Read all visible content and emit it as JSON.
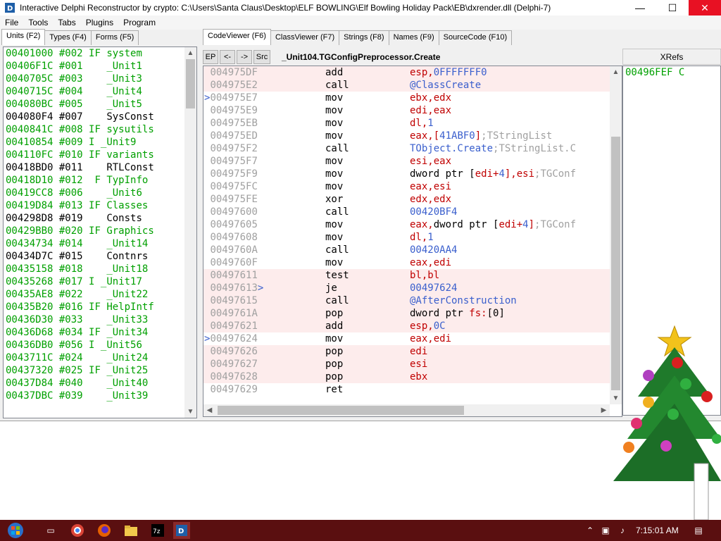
{
  "window": {
    "title": "Interactive Delphi Reconstructor by crypto: C:\\Users\\Santa Claus\\Desktop\\ELF BOWLING\\Elf Bowling Holiday Pack\\EB\\dxrender.dll (Delphi-7)",
    "minimize": "—",
    "maximize": "☐",
    "close": "✕"
  },
  "menu": [
    "File",
    "Tools",
    "Tabs",
    "Plugins",
    "Program"
  ],
  "left_tabs": [
    "Units (F2)",
    "Types (F4)",
    "Forms (F5)"
  ],
  "units": [
    {
      "addr": "00401000",
      "num": "#002",
      "flag": "IF",
      "name": "system",
      "color": "green"
    },
    {
      "addr": "00406F1C",
      "num": "#001",
      "flag": "",
      "name": "_Unit1",
      "color": "green"
    },
    {
      "addr": "0040705C",
      "num": "#003",
      "flag": "",
      "name": "_Unit3",
      "color": "green"
    },
    {
      "addr": "0040715C",
      "num": "#004",
      "flag": "",
      "name": "_Unit4",
      "color": "green"
    },
    {
      "addr": "004080BC",
      "num": "#005",
      "flag": "",
      "name": "_Unit5",
      "color": "green"
    },
    {
      "addr": "004080F4",
      "num": "#007",
      "flag": "",
      "name": "SysConst",
      "color": "black"
    },
    {
      "addr": "0040841C",
      "num": "#008",
      "flag": "IF",
      "name": "sysutils",
      "color": "green"
    },
    {
      "addr": "00410854",
      "num": "#009",
      "flag": "I",
      "name": "_Unit9",
      "color": "green"
    },
    {
      "addr": "004110FC",
      "num": "#010",
      "flag": "IF",
      "name": "variants",
      "color": "green"
    },
    {
      "addr": "00418BD0",
      "num": "#011",
      "flag": "",
      "name": "RTLConst",
      "color": "black"
    },
    {
      "addr": "00418D10",
      "num": "#012",
      "flag": " F",
      "name": "TypInfo",
      "color": "green"
    },
    {
      "addr": "00419CC8",
      "num": "#006",
      "flag": "",
      "name": "_Unit6",
      "color": "green"
    },
    {
      "addr": "00419D84",
      "num": "#013",
      "flag": "IF",
      "name": "Classes",
      "color": "green"
    },
    {
      "addr": "004298D8",
      "num": "#019",
      "flag": "",
      "name": "Consts",
      "color": "black"
    },
    {
      "addr": "00429BB0",
      "num": "#020",
      "flag": "IF",
      "name": "Graphics",
      "color": "green"
    },
    {
      "addr": "00434734",
      "num": "#014",
      "flag": "",
      "name": "_Unit14",
      "color": "green"
    },
    {
      "addr": "00434D7C",
      "num": "#015",
      "flag": "",
      "name": "Contnrs",
      "color": "black"
    },
    {
      "addr": "00435158",
      "num": "#018",
      "flag": "",
      "name": "_Unit18",
      "color": "green"
    },
    {
      "addr": "00435268",
      "num": "#017",
      "flag": "I",
      "name": "_Unit17",
      "color": "green"
    },
    {
      "addr": "00435AE8",
      "num": "#022",
      "flag": "",
      "name": "_Unit22",
      "color": "green"
    },
    {
      "addr": "00435B20",
      "num": "#016",
      "flag": "IF",
      "name": "HelpIntf",
      "color": "green"
    },
    {
      "addr": "00436D30",
      "num": "#033",
      "flag": "",
      "name": "_Unit33",
      "color": "green"
    },
    {
      "addr": "00436D68",
      "num": "#034",
      "flag": "IF",
      "name": "_Unit34",
      "color": "green"
    },
    {
      "addr": "00436DB0",
      "num": "#056",
      "flag": "I",
      "name": "_Unit56",
      "color": "green"
    },
    {
      "addr": "0043711C",
      "num": "#024",
      "flag": "",
      "name": "_Unit24",
      "color": "green"
    },
    {
      "addr": "00437320",
      "num": "#025",
      "flag": "IF",
      "name": "_Unit25",
      "color": "green"
    },
    {
      "addr": "00437D84",
      "num": "#040",
      "flag": "",
      "name": "_Unit40",
      "color": "green"
    },
    {
      "addr": "00437DBC",
      "num": "#039",
      "flag": "",
      "name": "_Unit39",
      "color": "green"
    }
  ],
  "right_tabs": [
    "CodeViewer (F6)",
    "ClassViewer (F7)",
    "Strings (F8)",
    "Names (F9)",
    "SourceCode (F10)"
  ],
  "toolbar": {
    "ep": "EP",
    "back": "<-",
    "forward": "->",
    "src": "Src",
    "proc_title": "_Unit104.TGConfigPreprocessor.Create"
  },
  "xrefs": {
    "header": "XRefs",
    "items": [
      "00496FEF C"
    ]
  },
  "code": [
    {
      "addr": "004975DF",
      "mark": "",
      "suffix": "",
      "mnem": "add",
      "hl": true,
      "parts": [
        [
          "esp,",
          "r"
        ],
        [
          "0FFFFFFF0",
          "b"
        ]
      ]
    },
    {
      "addr": "004975E2",
      "mark": "",
      "suffix": "",
      "mnem": "call",
      "hl": true,
      "parts": [
        [
          "@ClassCreate",
          "b"
        ]
      ]
    },
    {
      "addr": "004975E7",
      "mark": ">",
      "suffix": "",
      "mnem": "mov",
      "hl": false,
      "parts": [
        [
          "ebx,edx",
          "r"
        ]
      ]
    },
    {
      "addr": "004975E9",
      "mark": "",
      "suffix": "",
      "mnem": "mov",
      "hl": false,
      "parts": [
        [
          "edi,eax",
          "r"
        ]
      ]
    },
    {
      "addr": "004975EB",
      "mark": "",
      "suffix": "",
      "mnem": "mov",
      "hl": false,
      "parts": [
        [
          "dl,",
          "r"
        ],
        [
          "1",
          "b"
        ]
      ]
    },
    {
      "addr": "004975ED",
      "mark": "",
      "suffix": "",
      "mnem": "mov",
      "hl": false,
      "parts": [
        [
          "eax,[",
          "r"
        ],
        [
          "41ABF0",
          "b"
        ],
        [
          "]",
          "r"
        ],
        [
          ";TStringList",
          "g"
        ]
      ]
    },
    {
      "addr": "004975F2",
      "mark": "",
      "suffix": "",
      "mnem": "call",
      "hl": false,
      "parts": [
        [
          "TObject.Create",
          "b"
        ],
        [
          ";TStringList.C",
          "g"
        ]
      ]
    },
    {
      "addr": "004975F7",
      "mark": "",
      "suffix": "",
      "mnem": "mov",
      "hl": false,
      "parts": [
        [
          "esi,eax",
          "r"
        ]
      ]
    },
    {
      "addr": "004975F9",
      "mark": "",
      "suffix": "",
      "mnem": "mov",
      "hl": false,
      "parts": [
        [
          "dword ptr [",
          "k"
        ],
        [
          "edi+",
          "r"
        ],
        [
          "4",
          "b"
        ],
        [
          "],esi",
          "r"
        ],
        [
          ";TGConf",
          "g"
        ]
      ]
    },
    {
      "addr": "004975FC",
      "mark": "",
      "suffix": "",
      "mnem": "mov",
      "hl": false,
      "parts": [
        [
          "eax,esi",
          "r"
        ]
      ]
    },
    {
      "addr": "004975FE",
      "mark": "",
      "suffix": "",
      "mnem": "xor",
      "hl": false,
      "parts": [
        [
          "edx,edx",
          "r"
        ]
      ]
    },
    {
      "addr": "00497600",
      "mark": "",
      "suffix": "",
      "mnem": "call",
      "hl": false,
      "parts": [
        [
          "00420BF4",
          "b"
        ]
      ]
    },
    {
      "addr": "00497605",
      "mark": "",
      "suffix": "",
      "mnem": "mov",
      "hl": false,
      "parts": [
        [
          "eax,",
          "r"
        ],
        [
          "dword ptr [",
          "k"
        ],
        [
          "edi+",
          "r"
        ],
        [
          "4",
          "b"
        ],
        [
          "]",
          "r"
        ],
        [
          ";TGConf",
          "g"
        ]
      ]
    },
    {
      "addr": "00497608",
      "mark": "",
      "suffix": "",
      "mnem": "mov",
      "hl": false,
      "parts": [
        [
          "dl,",
          "r"
        ],
        [
          "1",
          "b"
        ]
      ]
    },
    {
      "addr": "0049760A",
      "mark": "",
      "suffix": "",
      "mnem": "call",
      "hl": false,
      "parts": [
        [
          "00420AA4",
          "b"
        ]
      ]
    },
    {
      "addr": "0049760F",
      "mark": "",
      "suffix": "",
      "mnem": "mov",
      "hl": false,
      "parts": [
        [
          "eax,edi",
          "r"
        ]
      ]
    },
    {
      "addr": "00497611",
      "mark": "",
      "suffix": "",
      "mnem": "test",
      "hl": true,
      "parts": [
        [
          "bl,bl",
          "r"
        ]
      ]
    },
    {
      "addr": "00497613",
      "mark": "",
      "suffix": ">",
      "mnem": "je",
      "hl": true,
      "parts": [
        [
          "00497624",
          "b"
        ]
      ]
    },
    {
      "addr": "00497615",
      "mark": "",
      "suffix": "",
      "mnem": "call",
      "hl": true,
      "parts": [
        [
          "@AfterConstruction",
          "b"
        ]
      ]
    },
    {
      "addr": "0049761A",
      "mark": "",
      "suffix": "",
      "mnem": "pop",
      "hl": true,
      "parts": [
        [
          "dword ptr ",
          "k"
        ],
        [
          "fs:",
          "r"
        ],
        [
          "[0]",
          "k"
        ]
      ]
    },
    {
      "addr": "00497621",
      "mark": "",
      "suffix": "",
      "mnem": "add",
      "hl": true,
      "parts": [
        [
          "esp,",
          "r"
        ],
        [
          "0C",
          "b"
        ]
      ]
    },
    {
      "addr": "00497624",
      "mark": ">",
      "suffix": "",
      "mnem": "mov",
      "hl": false,
      "parts": [
        [
          "eax,edi",
          "r"
        ]
      ]
    },
    {
      "addr": "00497626",
      "mark": "",
      "suffix": "",
      "mnem": "pop",
      "hl": true,
      "parts": [
        [
          "edi",
          "r"
        ]
      ]
    },
    {
      "addr": "00497627",
      "mark": "",
      "suffix": "",
      "mnem": "pop",
      "hl": true,
      "parts": [
        [
          "esi",
          "r"
        ]
      ]
    },
    {
      "addr": "00497628",
      "mark": "",
      "suffix": "",
      "mnem": "pop",
      "hl": true,
      "parts": [
        [
          "ebx",
          "r"
        ]
      ]
    },
    {
      "addr": "00497629",
      "mark": "",
      "suffix": "",
      "mnem": "ret",
      "hl": false,
      "parts": []
    }
  ],
  "taskbar": {
    "clock": "7:15:01 AM"
  }
}
